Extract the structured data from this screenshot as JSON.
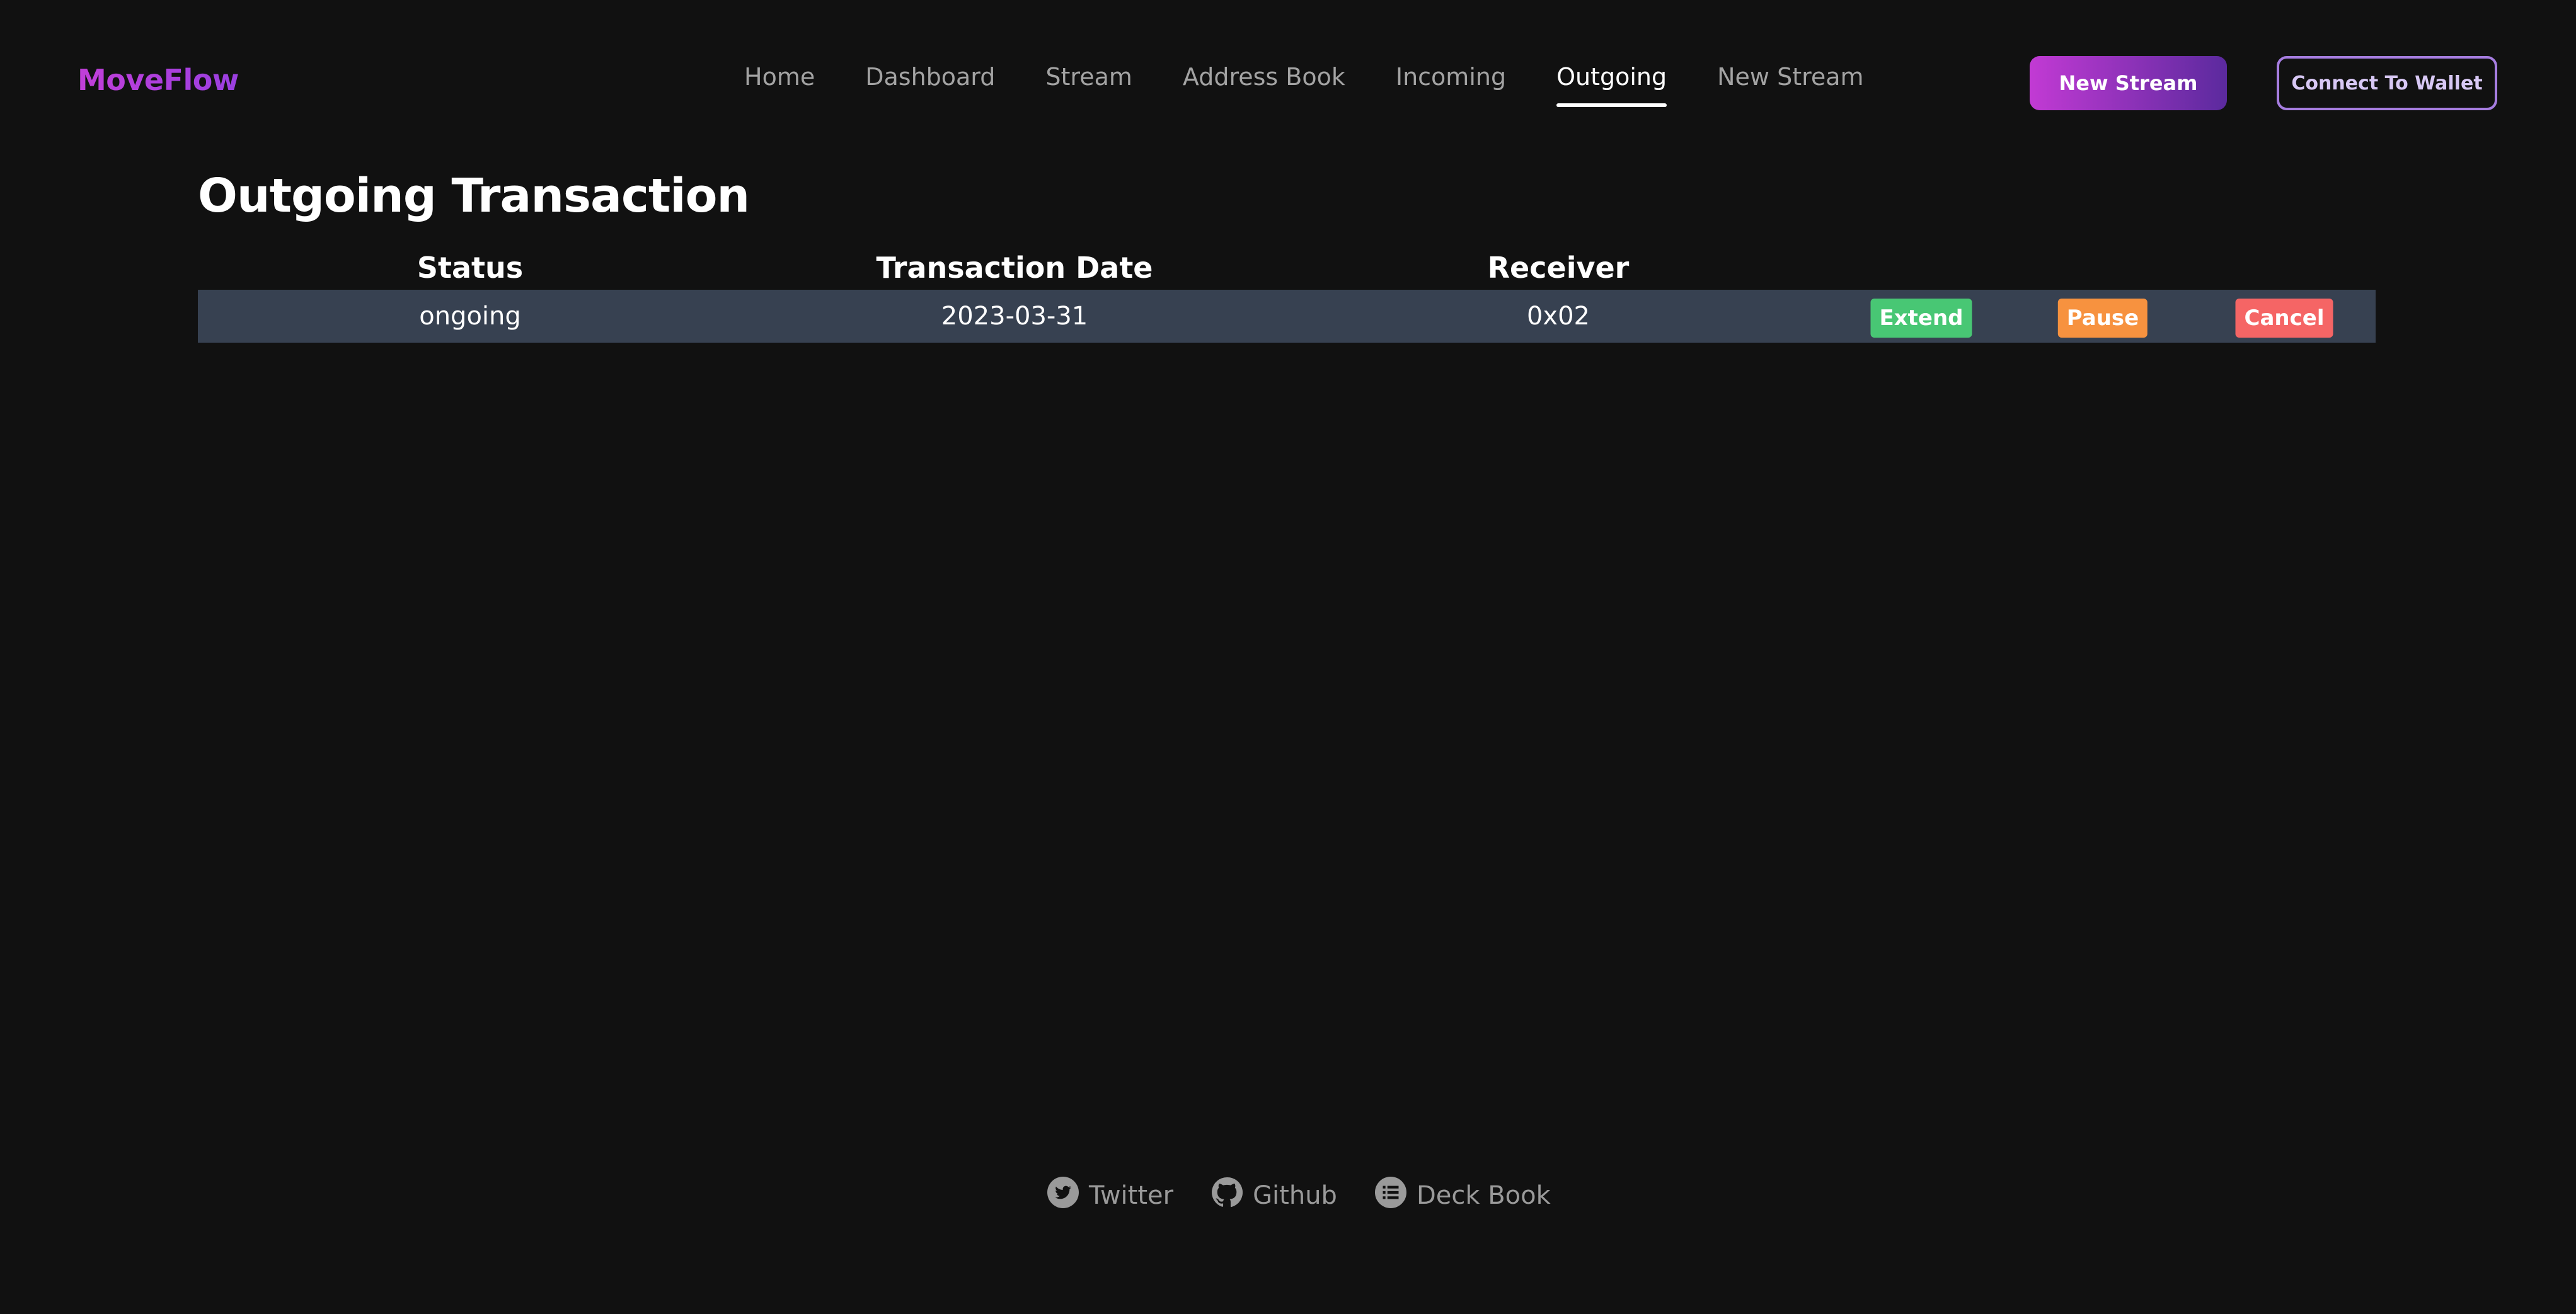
{
  "header": {
    "logo": "MoveFlow",
    "nav": [
      {
        "label": "Home",
        "active": false
      },
      {
        "label": "Dashboard",
        "active": false
      },
      {
        "label": "Stream",
        "active": false
      },
      {
        "label": "Address Book",
        "active": false
      },
      {
        "label": "Incoming",
        "active": false
      },
      {
        "label": "Outgoing",
        "active": true
      },
      {
        "label": "New Stream",
        "active": false
      }
    ],
    "new_stream_button": "New Stream",
    "connect_wallet_button": "Connect To Wallet"
  },
  "main": {
    "title": "Outgoing Transaction",
    "table": {
      "columns": [
        "Status",
        "Transaction Date",
        "Receiver"
      ],
      "rows": [
        {
          "status": "ongoing",
          "date": "2023-03-31",
          "receiver": "0x02",
          "actions": {
            "extend": "Extend",
            "pause": "Pause",
            "cancel": "Cancel"
          }
        }
      ]
    }
  },
  "footer": {
    "links": [
      {
        "label": "Twitter",
        "icon": "twitter-icon"
      },
      {
        "label": "Github",
        "icon": "github-icon"
      },
      {
        "label": "Deck Book",
        "icon": "list-icon"
      }
    ]
  },
  "colors": {
    "background": "#111111",
    "row_background": "#374151",
    "brand_gradient_start": "#c23fd9",
    "brand_gradient_end": "#5b2a9e",
    "extend": "#48c774",
    "pause": "#f7923f",
    "cancel": "#f56565"
  }
}
